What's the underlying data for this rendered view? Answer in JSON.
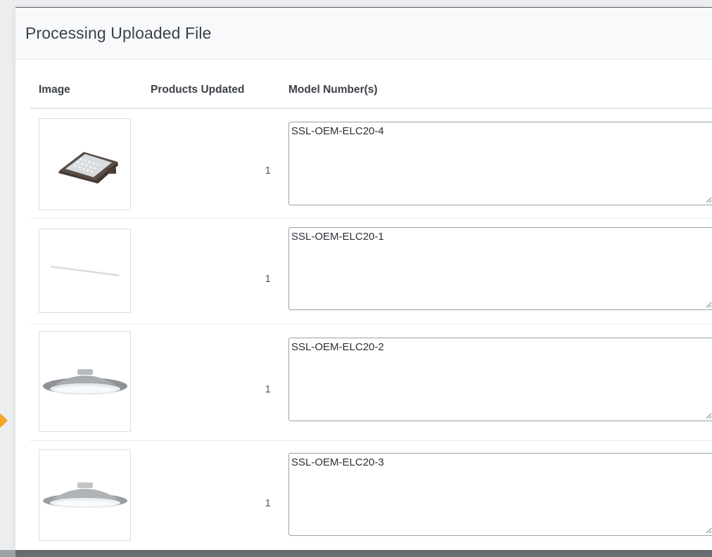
{
  "panel": {
    "title": "Processing Uploaded File"
  },
  "table": {
    "headers": {
      "image": "Image",
      "products_updated": "Products Updated",
      "model_numbers": "Model Number(s)"
    },
    "rows": [
      {
        "image_icon": "area-light-fixture-image",
        "products_updated": "1",
        "model_numbers": "SSL-OEM-ELC20-4"
      },
      {
        "image_icon": "linear-tube-light-image",
        "products_updated": "1",
        "model_numbers": "SSL-OEM-ELC20-1"
      },
      {
        "image_icon": "canopy-light-fixture-image",
        "products_updated": "1",
        "model_numbers": "SSL-OEM-ELC20-2"
      },
      {
        "image_icon": "canopy-light-fixture-image",
        "products_updated": "1",
        "model_numbers": "SSL-OEM-ELC20-3"
      }
    ]
  },
  "colors": {
    "header_bg": "#f8f9fb",
    "border": "#e4e6e9",
    "accent_marker": "#f5a623",
    "text": "#3b4148"
  }
}
